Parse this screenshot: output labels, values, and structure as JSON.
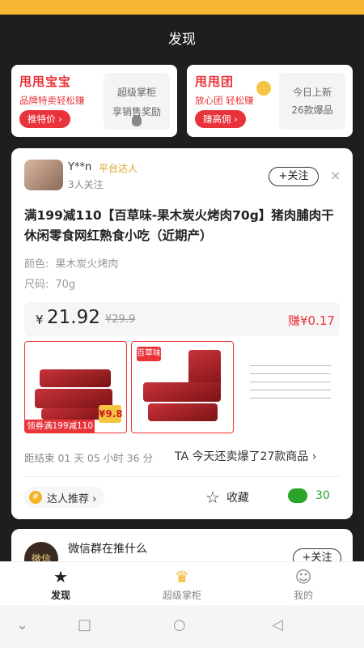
{
  "header": {
    "title": "发现"
  },
  "banners": [
    {
      "brand": "甩甩宝宝",
      "tagline": "品牌特卖轻松赚",
      "cta": "推特价 ›",
      "right_line1": "超级掌柜",
      "right_line2": "享销售奖励"
    },
    {
      "brand": "甩甩团",
      "tagline": "放心团 轻松赚",
      "cta": "赚高佣 ›",
      "right_line1": "今日上新",
      "right_line2": "26款爆品"
    }
  ],
  "post": {
    "user_name": "Y**n",
    "user_badge": "平台达人",
    "followers": "3人关注",
    "follow_label": "+关注",
    "close": "×",
    "product_title": "满199减110【百草味-果木炭火烤肉70g】猪肉脯肉干休闲零食网红熟食小吃（近期产）",
    "spec_color_label": "颜色:",
    "spec_color_value": "果木炭火烤肉",
    "spec_size_label": "尺码:",
    "spec_size_value": "70g",
    "currency": "¥",
    "price": "21.92",
    "old_price": "¥29.9",
    "earn": "赚¥0.17",
    "image_promo": "领券满199减110",
    "image_tag": "¥9.8",
    "image_logo": "百草味",
    "countdown": "距结束 01 天 05 小时 36 分",
    "sold": "TA 今天还卖爆了27款商品 ›",
    "recommend": "达人推荐 ›",
    "recommend_icon": "#",
    "favorite": "收藏",
    "wechat_count": "30"
  },
  "post2": {
    "avatar_text": "微信",
    "title": "微信群在推什么",
    "follow_label": "+关注"
  },
  "tabs": [
    {
      "label": "发现",
      "icon": "star-icon"
    },
    {
      "label": "超级掌柜",
      "icon": "crown-icon"
    },
    {
      "label": "我的",
      "icon": "smile-icon"
    }
  ],
  "colors": {
    "accent": "#f7b733",
    "price_red": "#e8333a",
    "wechat_green": "#2aa52a"
  }
}
